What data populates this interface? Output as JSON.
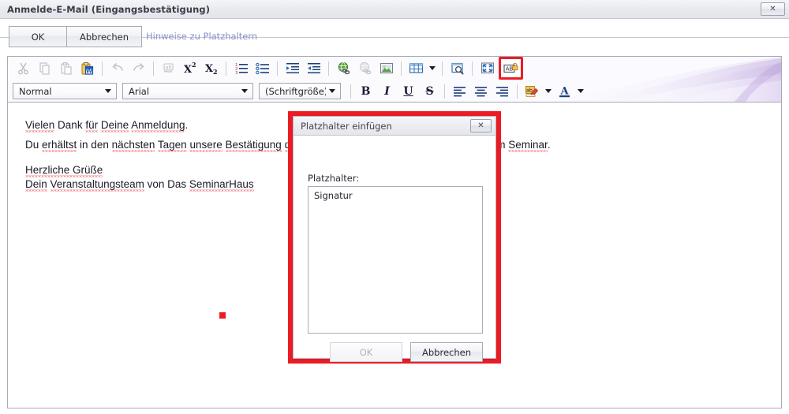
{
  "window": {
    "title": "Anmelde-E-Mail (Eingangsbestätigung)",
    "close_label": "✕"
  },
  "commandbar": {
    "ok_label": "OK",
    "cancel_label": "Abbrechen",
    "hint_link_label": "Hinweise zu Platzhaltern",
    "link_color": "#8b8ec9"
  },
  "toolbar": {
    "row1": [
      {
        "name": "cut-icon",
        "title": "Ausschneiden",
        "disabled": true
      },
      {
        "name": "copy-icon",
        "title": "Kopieren",
        "disabled": true
      },
      {
        "name": "paste-icon",
        "title": "Einfügen",
        "disabled": true
      },
      {
        "name": "paste-from-word-icon",
        "title": "Aus Word einfügen",
        "disabled": false
      },
      {
        "name": "separator",
        "title": "",
        "disabled": false
      },
      {
        "name": "undo-icon",
        "title": "Rückgängig",
        "disabled": true
      },
      {
        "name": "redo-icon",
        "title": "Wiederholen",
        "disabled": true
      },
      {
        "name": "separator",
        "title": "",
        "disabled": false
      },
      {
        "name": "spellcheck-icon",
        "title": "Rechtschreibprüfung",
        "disabled": true
      },
      {
        "name": "superscript-icon",
        "title": "Hochgestellt",
        "disabled": false
      },
      {
        "name": "subscript-icon",
        "title": "Tiefgestellt",
        "disabled": false
      },
      {
        "name": "separator",
        "title": "",
        "disabled": false
      },
      {
        "name": "numbered-list-icon",
        "title": "Nummerierte Liste",
        "disabled": false
      },
      {
        "name": "bulleted-list-icon",
        "title": "Aufzählung",
        "disabled": false
      },
      {
        "name": "separator",
        "title": "",
        "disabled": false
      },
      {
        "name": "indent-increase-icon",
        "title": "Einzug vergrößern",
        "disabled": false
      },
      {
        "name": "indent-decrease-icon",
        "title": "Einzug verkleinern",
        "disabled": false
      },
      {
        "name": "separator",
        "title": "",
        "disabled": false
      },
      {
        "name": "insert-link-icon",
        "title": "Link einfügen",
        "disabled": false
      },
      {
        "name": "remove-link-icon",
        "title": "Link entfernen",
        "disabled": true
      },
      {
        "name": "insert-image-icon",
        "title": "Bild einfügen",
        "disabled": false
      },
      {
        "name": "separator",
        "title": "",
        "disabled": false
      },
      {
        "name": "insert-table-icon",
        "title": "Tabelle einfügen",
        "disabled": false
      },
      {
        "name": "table-dropdown-caret",
        "title": "",
        "disabled": false
      },
      {
        "name": "separator",
        "title": "",
        "disabled": false
      },
      {
        "name": "source-view-icon",
        "title": "Quelltext",
        "disabled": false
      },
      {
        "name": "separator",
        "title": "",
        "disabled": false
      },
      {
        "name": "fullscreen-icon",
        "title": "Vollbild",
        "disabled": false
      },
      {
        "name": "insert-placeholder-icon",
        "title": "Platzhalter einfügen",
        "disabled": false,
        "highlighted": true
      }
    ],
    "selects": {
      "style": {
        "value": "Normal"
      },
      "font": {
        "value": "Arial"
      },
      "font_size": {
        "value": "(Schriftgröße)"
      }
    },
    "format_buttons": [
      {
        "name": "bold-button",
        "label": "B",
        "style": "bold"
      },
      {
        "name": "italic-button",
        "label": "I",
        "style": "ital"
      },
      {
        "name": "underline-button",
        "label": "U",
        "style": "und"
      },
      {
        "name": "strikethrough-button",
        "label": "S",
        "style": "strike"
      }
    ],
    "align_buttons": [
      {
        "name": "align-left-button"
      },
      {
        "name": "align-center-button"
      },
      {
        "name": "align-right-button"
      }
    ],
    "highlight_color_label": "A",
    "highlight_box_color": "#ed1c24"
  },
  "document": {
    "paragraphs": [
      {
        "name": "paragraph-thanks",
        "text": "Vielen Dank für Deine Anmeldung."
      },
      {
        "name": "paragraph-confirm",
        "text": "Du erhältst in den nächsten Tagen unsere Bestätigung der Anmeldung und weitere Informationen zum Seminar."
      },
      {
        "name": "paragraph-greeting",
        "text": "Herzliche Grüße"
      },
      {
        "name": "paragraph-signoff",
        "text": "Dein Veranstaltungsteam von Das SeminarHaus"
      }
    ],
    "marker_color": "#ed1c24"
  },
  "modal": {
    "title": "Platzhalter einfügen",
    "close_label": "✕",
    "field_label": "Platzhalter:",
    "listbox_items": [
      "Signatur"
    ],
    "ok_label": "OK",
    "ok_disabled": true,
    "cancel_label": "Abbrechen"
  }
}
